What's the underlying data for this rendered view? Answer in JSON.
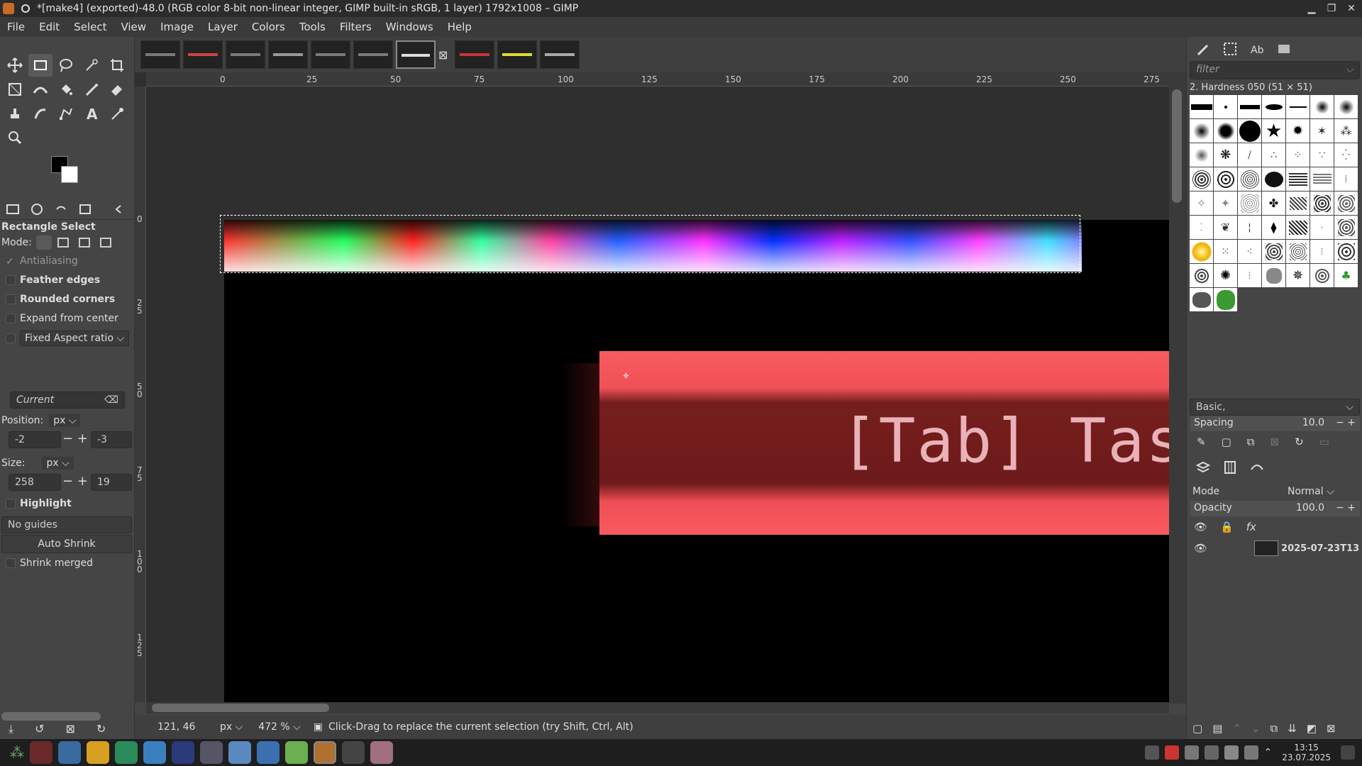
{
  "window": {
    "title": "*[make4] (exported)-48.0 (RGB color 8-bit non-linear integer, GIMP built-in sRGB, 1 layer) 1792x1008 – GIMP"
  },
  "menu": [
    "File",
    "Edit",
    "Select",
    "View",
    "Image",
    "Layer",
    "Colors",
    "Tools",
    "Filters",
    "Windows",
    "Help"
  ],
  "tool_options": {
    "title": "Rectangle Select",
    "mode_label": "Mode:",
    "antialiasing": "Antialiasing",
    "feather_edges": "Feather edges",
    "rounded_corners": "Rounded corners",
    "expand_from_center": "Expand from center",
    "fixed_aspect": "Fixed Aspect ratio",
    "current": "Current",
    "position_label": "Position:",
    "position_unit": "px",
    "pos_x": "-2",
    "pos_y": "-3",
    "size_label": "Size:",
    "size_unit": "px",
    "size_w": "258",
    "size_h": "19",
    "highlight": "Highlight",
    "guides": "No guides",
    "auto_shrink": "Auto Shrink",
    "shrink_merged": "Shrink merged"
  },
  "ruler_h": [
    "0",
    "25",
    "50",
    "75",
    "100",
    "125",
    "150",
    "175",
    "200",
    "225",
    "250",
    "275"
  ],
  "ruler_v": [
    "0",
    "2\n5",
    "5\n0",
    "7\n5",
    "1\n0\n0",
    "1\n2\n5"
  ],
  "canvas_text": "[Tab] Tasks",
  "status": {
    "coords": "121, 46",
    "unit": "px",
    "zoom": "472 %",
    "message": "Click-Drag to replace the current selection (try Shift, Ctrl, Alt)"
  },
  "brushes": {
    "filter_placeholder": "filter",
    "selected": "2. Hardness 050 (51 × 51)",
    "preset": "Basic,",
    "spacing_label": "Spacing",
    "spacing_value": "10.0"
  },
  "layers": {
    "mode_label": "Mode",
    "mode_value": "Normal",
    "opacity_label": "Opacity",
    "opacity_value": "100.0",
    "layer_name": "2025-07-23T13"
  },
  "clock": {
    "time": "13:15",
    "date": "23.07.2025"
  }
}
